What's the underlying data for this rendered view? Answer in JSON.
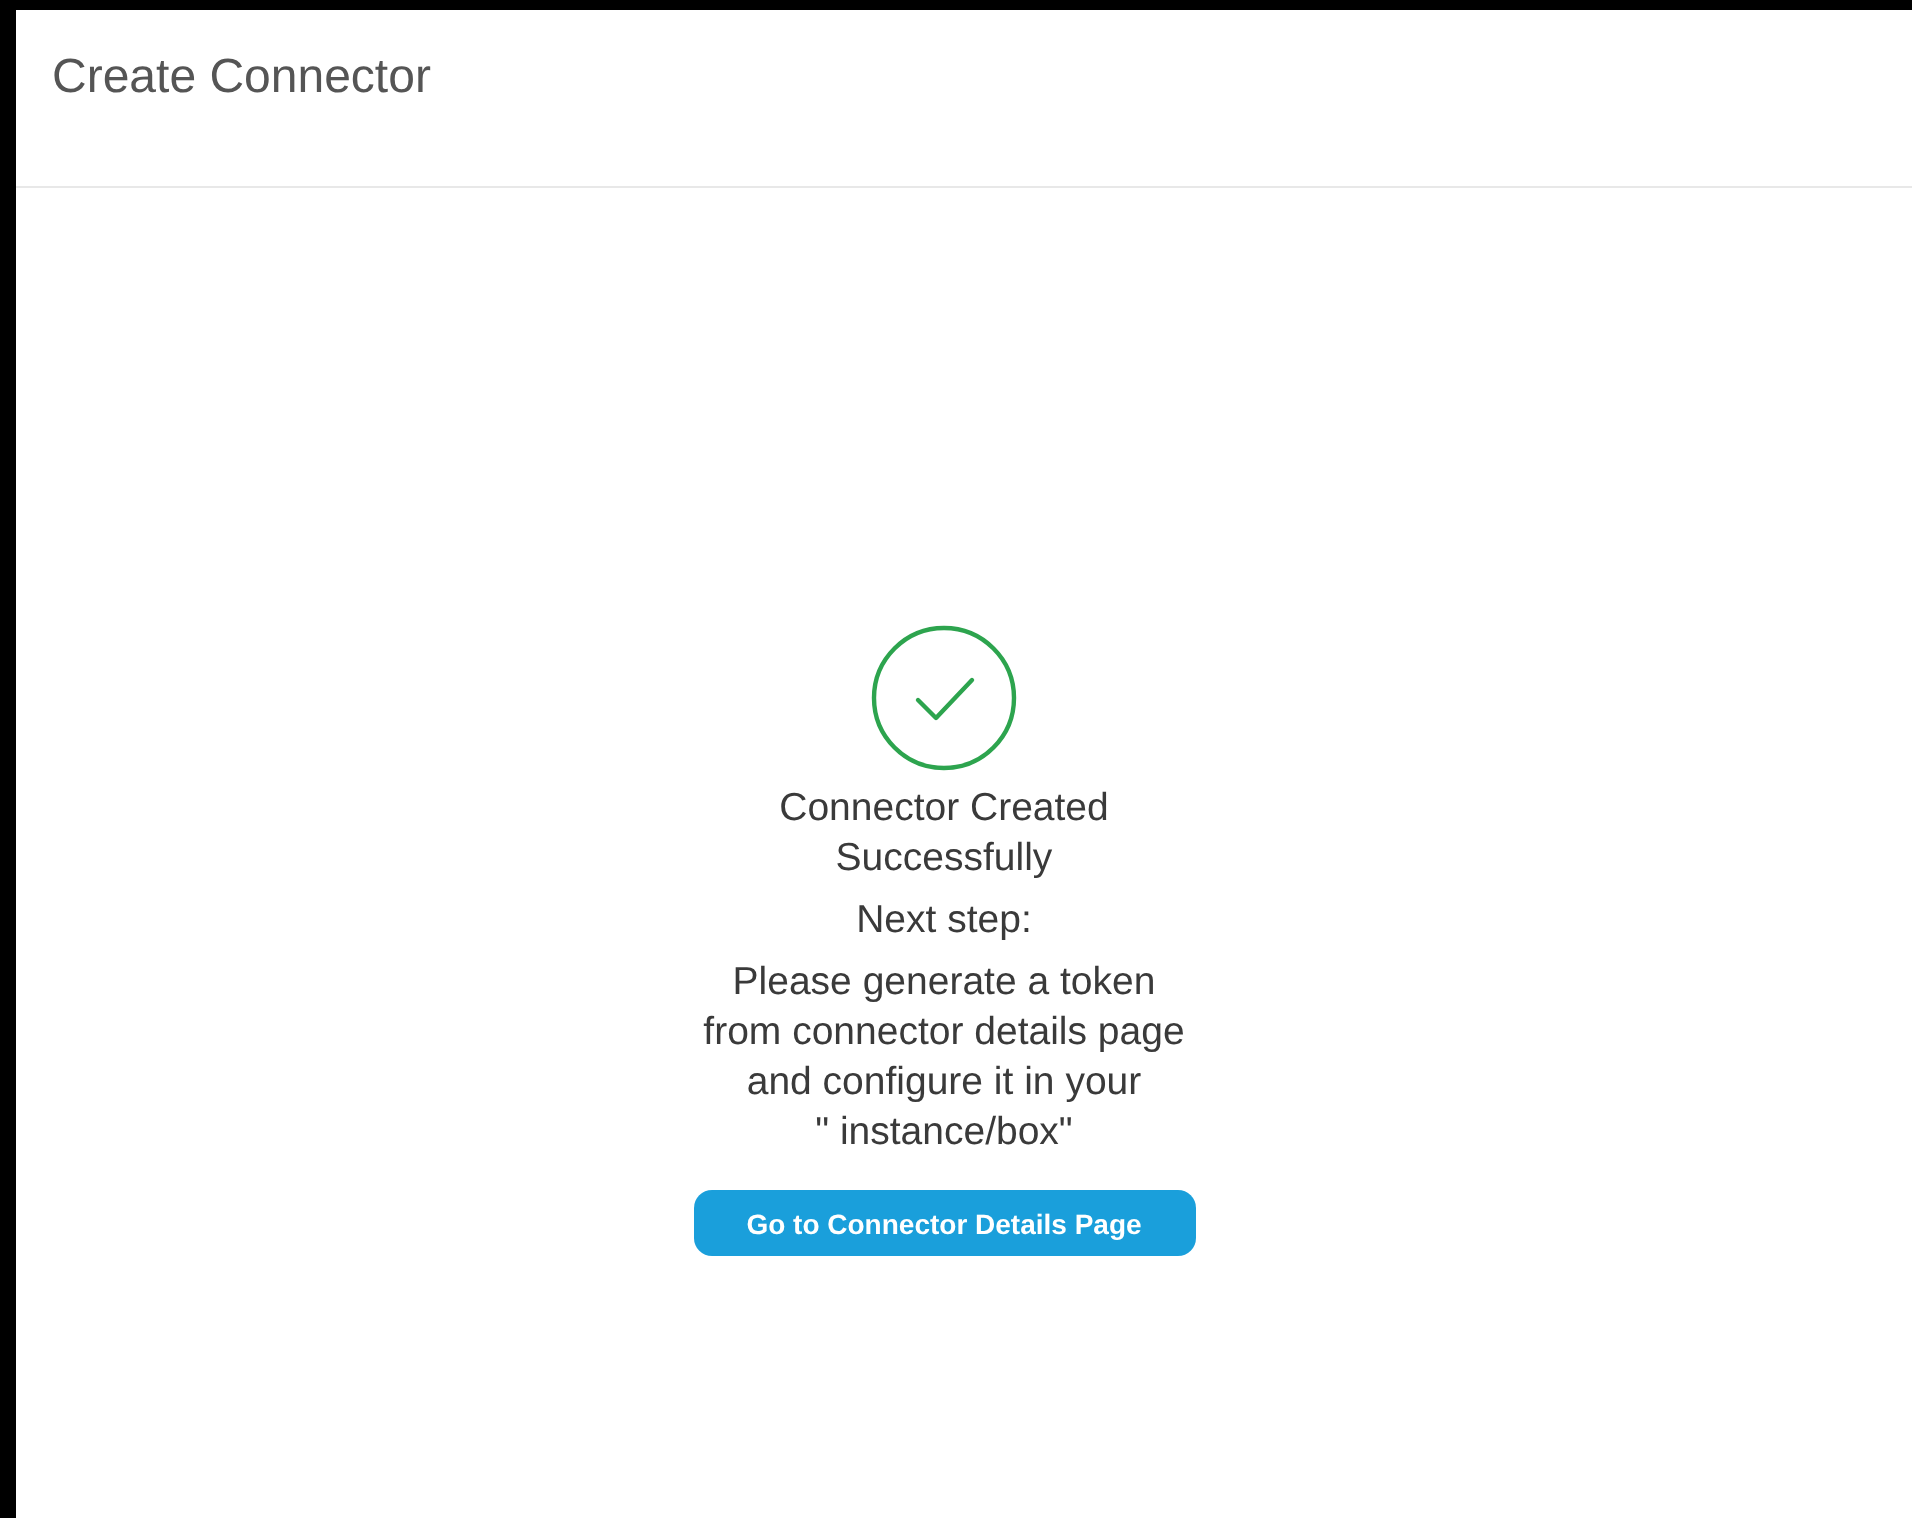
{
  "header": {
    "title": "Create Connector"
  },
  "result": {
    "heading_lines": [
      "Connector Created",
      "Successfully"
    ],
    "next_step_label": "Next step:",
    "instruction_lines": [
      "Please generate a token",
      "from connector details page",
      "and configure it in your",
      "\" instance/box\""
    ],
    "button": "Go to Connector Details Page"
  }
}
